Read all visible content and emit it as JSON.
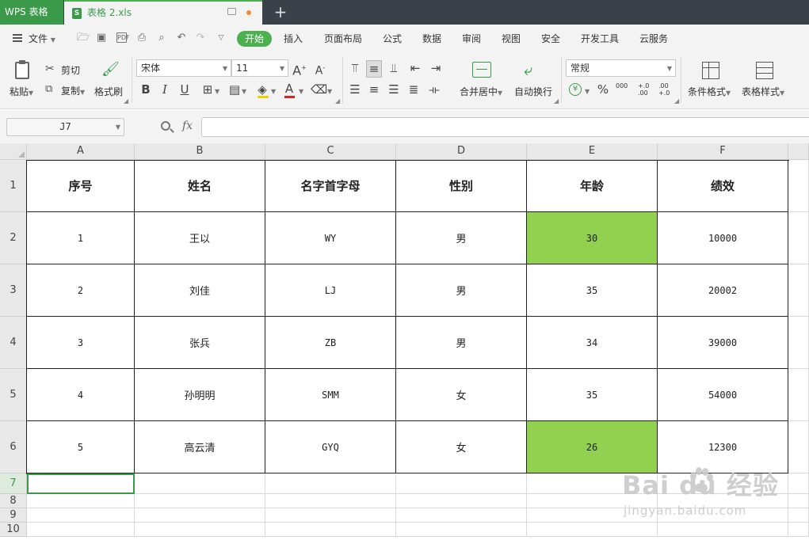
{
  "titlebar": {
    "app_name": "WPS 表格",
    "doc_name": "表格 2.xls",
    "xls_badge": "S",
    "new_tab": "+"
  },
  "menubar": {
    "file": "文件",
    "items": [
      "开始",
      "插入",
      "页面布局",
      "公式",
      "数据",
      "审阅",
      "视图",
      "安全",
      "开发工具",
      "云服务"
    ],
    "active": "开始"
  },
  "ribbon": {
    "paste": "粘贴",
    "cut": "剪切",
    "copy": "复制",
    "format_painter": "格式刷",
    "font_name": "宋体",
    "font_size": "11",
    "merge_center": "合并居中",
    "wrap_text": "自动换行",
    "number_format": "常规",
    "conditional_format": "条件格式",
    "table_style": "表格样式",
    "currency_symbol": "¥",
    "percent_symbol": "%",
    "thousands": "000",
    "inc_decimal": "+.0 .00",
    "dec_decimal": ".00 +.0"
  },
  "formulabar": {
    "cell_ref": "J7",
    "fx": "fx",
    "formula": ""
  },
  "grid": {
    "columns": [
      "A",
      "B",
      "C",
      "D",
      "E",
      "F"
    ],
    "rows": [
      "1",
      "2",
      "3",
      "4",
      "5",
      "6",
      "7",
      "8",
      "9",
      "10"
    ],
    "selected_row": "7",
    "header": [
      "序号",
      "姓名",
      "名字首字母",
      "性别",
      "年龄",
      "绩效"
    ],
    "data": [
      [
        "1",
        "王以",
        "WY",
        "男",
        "30",
        "10000"
      ],
      [
        "2",
        "刘佳",
        "LJ",
        "男",
        "35",
        "20002"
      ],
      [
        "3",
        "张兵",
        "ZB",
        "男",
        "34",
        "39000"
      ],
      [
        "4",
        "孙明明",
        "SMM",
        "女",
        "35",
        "54000"
      ],
      [
        "5",
        "高云清",
        "GYQ",
        "女",
        "26",
        "12300"
      ]
    ],
    "highlight_color": "#92d050"
  },
  "watermark": {
    "main": "Bai  du 经验",
    "sub": "jingyan.baidu.com"
  }
}
